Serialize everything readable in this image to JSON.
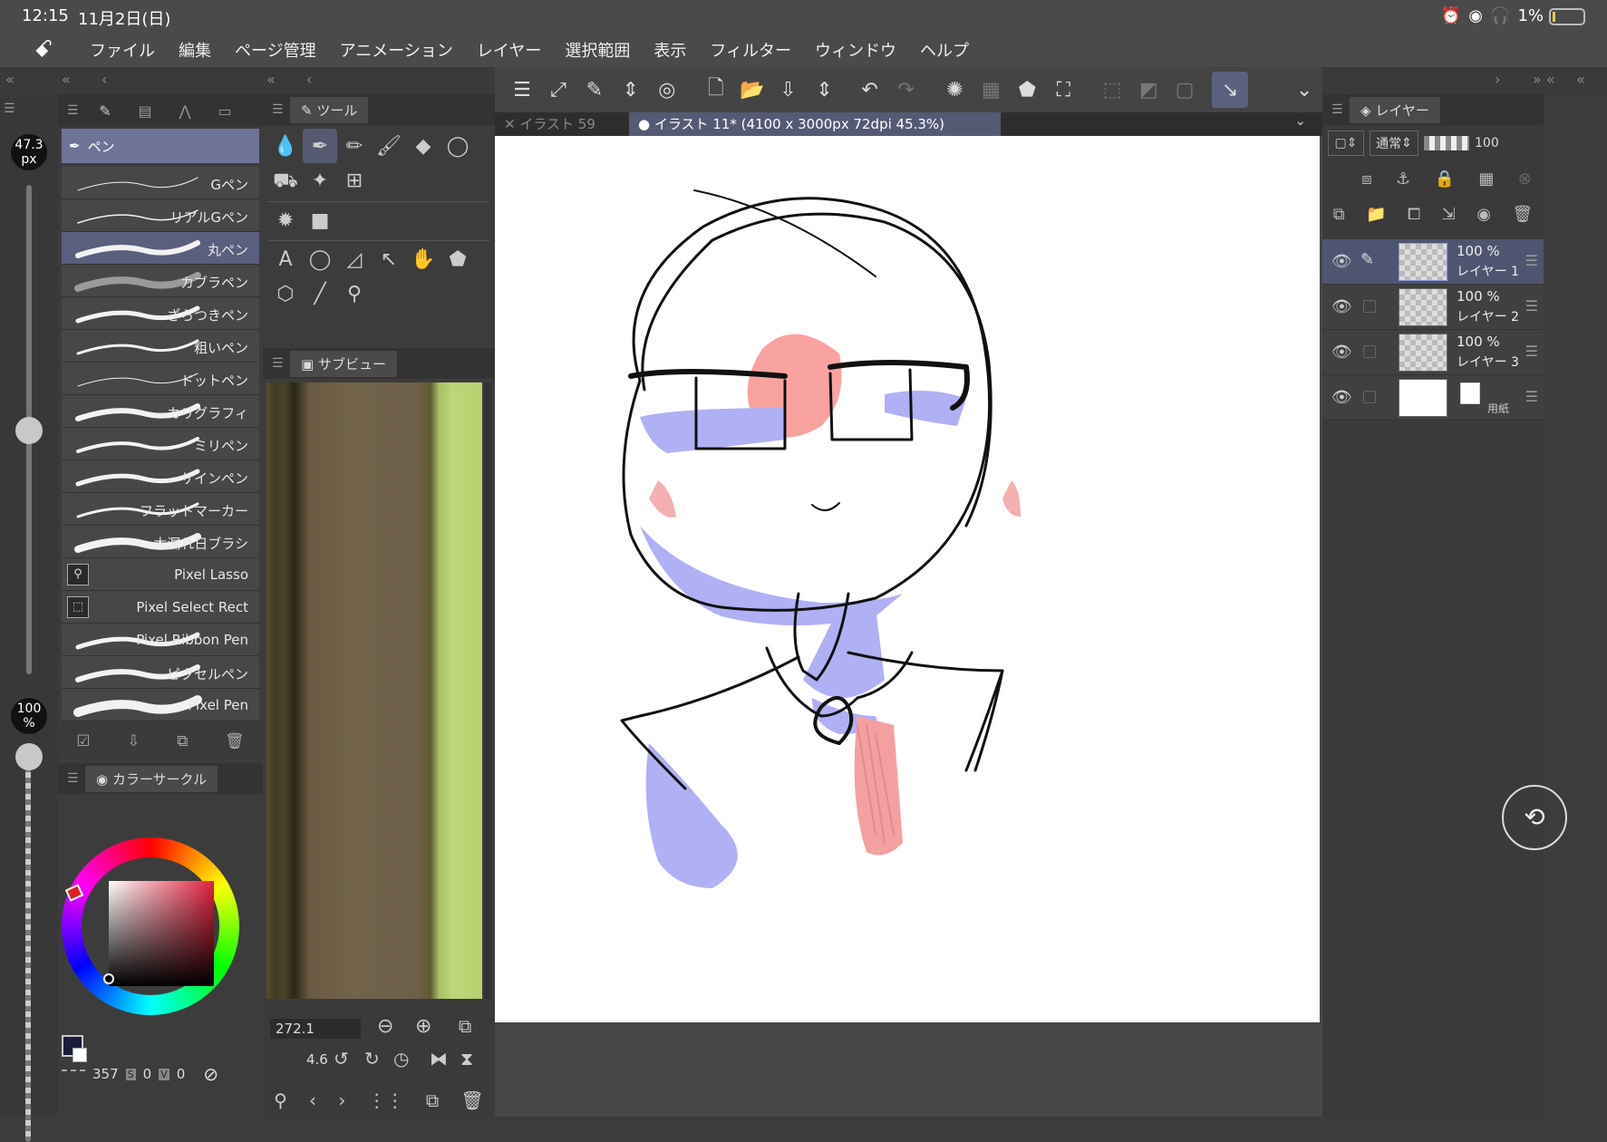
{
  "status": {
    "time": "12:15",
    "date": "11月2日(日)",
    "battery": "1%"
  },
  "menu": {
    "items": [
      "ファイル",
      "編集",
      "ページ管理",
      "アニメーション",
      "レイヤー",
      "選択範囲",
      "表示",
      "フィルター",
      "ウィンドウ",
      "ヘルプ"
    ]
  },
  "left": {
    "size_value": "47.3",
    "size_unit": "px",
    "opacity_value": "100",
    "opacity_unit": "%"
  },
  "brush_panel": {
    "selected_group": "ペン",
    "brushes": [
      "Gペン",
      "リアルGペン",
      "丸ペン",
      "カブラペン",
      "ざらつきペン",
      "粗いペン",
      "ドットペン",
      "カリグラフィ",
      "ミリペン",
      "サインペン",
      "フラットマーカー",
      "木漏れ日ブラシ",
      "Pixel Lasso",
      "Pixel Select Rect",
      "Pixel Ribbon Pen",
      "ピクセルペン",
      "Pixel Pen"
    ],
    "selected_index": 2
  },
  "color_panel": {
    "title": "カラーサークル",
    "h": "357",
    "h_label": "S",
    "s": "0",
    "s_label": "V",
    "v": "0"
  },
  "tool_panel": {
    "title": "ツール"
  },
  "subview": {
    "title": "サブビュー"
  },
  "navigator": {
    "zoom": "272.1",
    "angle": "4.6"
  },
  "tabs": {
    "inactive": "イラスト 59",
    "active": "イラスト 11* (4100 x 3000px 72dpi 45.3%)"
  },
  "layers": {
    "title": "レイヤー",
    "blend_mode": "通常",
    "opacity": "100",
    "rows": [
      {
        "pct": "100 %",
        "name": "レイヤー 1",
        "selected": true
      },
      {
        "pct": "100 %",
        "name": "レイヤー 2",
        "selected": false
      },
      {
        "pct": "100 %",
        "name": "レイヤー 3",
        "selected": false
      },
      {
        "pct": "",
        "name": "用紙",
        "selected": false
      }
    ]
  }
}
